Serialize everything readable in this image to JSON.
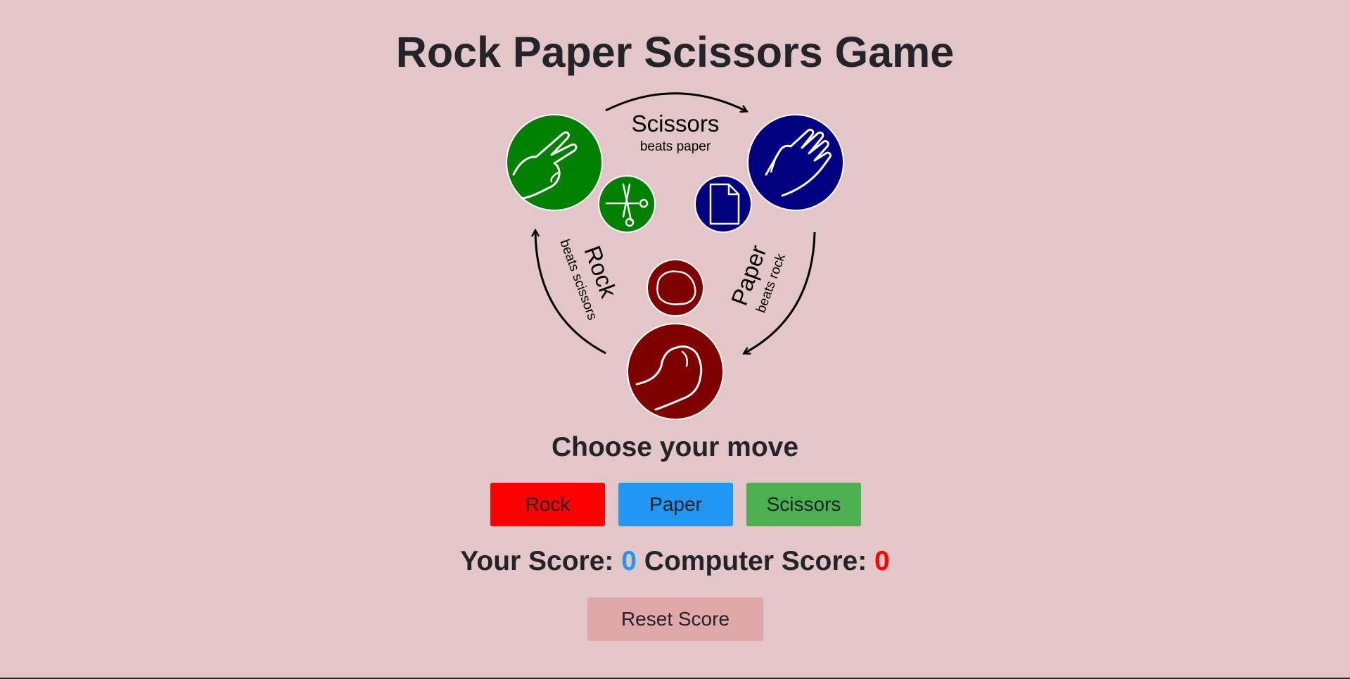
{
  "title": "Rock Paper Scissors Game",
  "diagram": {
    "scissors": {
      "label": "Scissors",
      "sub": "beats paper"
    },
    "paper": {
      "label": "Paper",
      "sub": "beats rock"
    },
    "rock": {
      "label": "Rock",
      "sub": "beats scissors"
    },
    "colors": {
      "scissors": "#008000",
      "paper": "#000080",
      "rock": "#800000"
    }
  },
  "choose_label": "Choose your move",
  "buttons": {
    "rock": {
      "label": "Rock",
      "color": "#ff0000"
    },
    "paper": {
      "label": "Paper",
      "color": "#2196f3"
    },
    "scissors": {
      "label": "Scissors",
      "color": "#4caf50"
    }
  },
  "score": {
    "your_label": "Your Score:",
    "your_value": "0",
    "your_color": "#2196f3",
    "computer_label": "Computer Score:",
    "computer_value": "0",
    "computer_color": "#ff0000"
  },
  "reset": {
    "label": "Reset Score",
    "color": "#e0a8a9"
  }
}
